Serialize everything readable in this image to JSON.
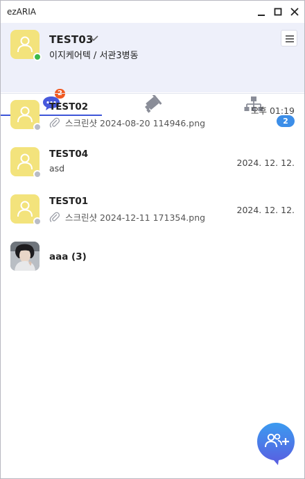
{
  "window": {
    "title": "ezARIA",
    "minimize_icon": "minimize-icon",
    "maximize_icon": "maximize-icon",
    "close_icon": "close-icon"
  },
  "profile": {
    "name": "TEST03",
    "org": "이지케어텍 / 서관3병동",
    "status_color": "#3cb94a",
    "avatar_icon": "user-icon"
  },
  "tabs": [
    {
      "icon": "chat-bubble-icon",
      "badge": "2",
      "active": true
    },
    {
      "icon": "broadcast-icon",
      "active": false
    },
    {
      "icon": "org-chart-icon",
      "active": false
    }
  ],
  "chats": [
    {
      "name": "TEST02",
      "attachment": true,
      "preview": "스크린샷 2024-08-20 114946.png",
      "time": "오후 01:19",
      "unread": "2"
    },
    {
      "name": "TEST04",
      "attachment": false,
      "preview": "asd",
      "time": "2024. 12. 12."
    },
    {
      "name": "TEST01",
      "attachment": true,
      "preview": "스크린샷 2024-12-11 171354.png",
      "time": "2024. 12. 12."
    },
    {
      "name": "aaa (3)",
      "attachment": false,
      "preview": "",
      "time": "",
      "photo_avatar": true
    }
  ],
  "fab": {
    "icon": "add-group-chat-icon"
  },
  "colors": {
    "accent": "#3d55d8",
    "header_bg": "#eef0fa",
    "avatar_bg": "#f3e37c",
    "badge_orange": "#f05a22",
    "unread_blue": "#3c8ee8",
    "offline_gray": "#b9bcc6"
  }
}
